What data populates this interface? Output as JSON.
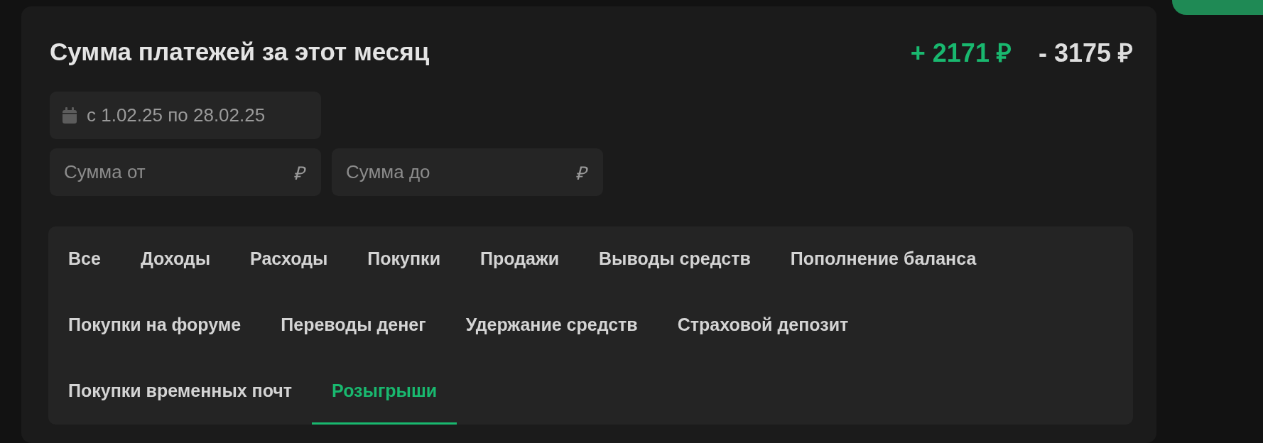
{
  "title": "Сумма платежей за этот месяц",
  "totals": [
    {
      "kind": "income",
      "text": "+ 2171 ₽"
    },
    {
      "kind": "expense",
      "text": "- 3175 ₽"
    }
  ],
  "date_range": {
    "value": "с 1.02.25 по 28.02.25"
  },
  "amount_fields": [
    {
      "placeholder": "Сумма от",
      "suffix": "₽"
    },
    {
      "placeholder": "Сумма до",
      "suffix": "₽"
    }
  ],
  "tabs": [
    [
      {
        "label": "Все",
        "selected": false
      },
      {
        "label": "Доходы",
        "selected": false
      },
      {
        "label": "Расходы",
        "selected": false
      },
      {
        "label": "Покупки",
        "selected": false
      },
      {
        "label": "Продажи",
        "selected": false
      },
      {
        "label": "Выводы средств",
        "selected": false
      },
      {
        "label": "Пополнение баланса",
        "selected": false
      }
    ],
    [
      {
        "label": "Покупки на форуме",
        "selected": false
      },
      {
        "label": "Переводы денег",
        "selected": false
      },
      {
        "label": "Удержание средств",
        "selected": false
      },
      {
        "label": "Страховой депозит",
        "selected": false
      }
    ],
    [
      {
        "label": "Покупки временных почт",
        "selected": false
      },
      {
        "label": "Розыгрыши",
        "selected": true
      }
    ]
  ]
}
